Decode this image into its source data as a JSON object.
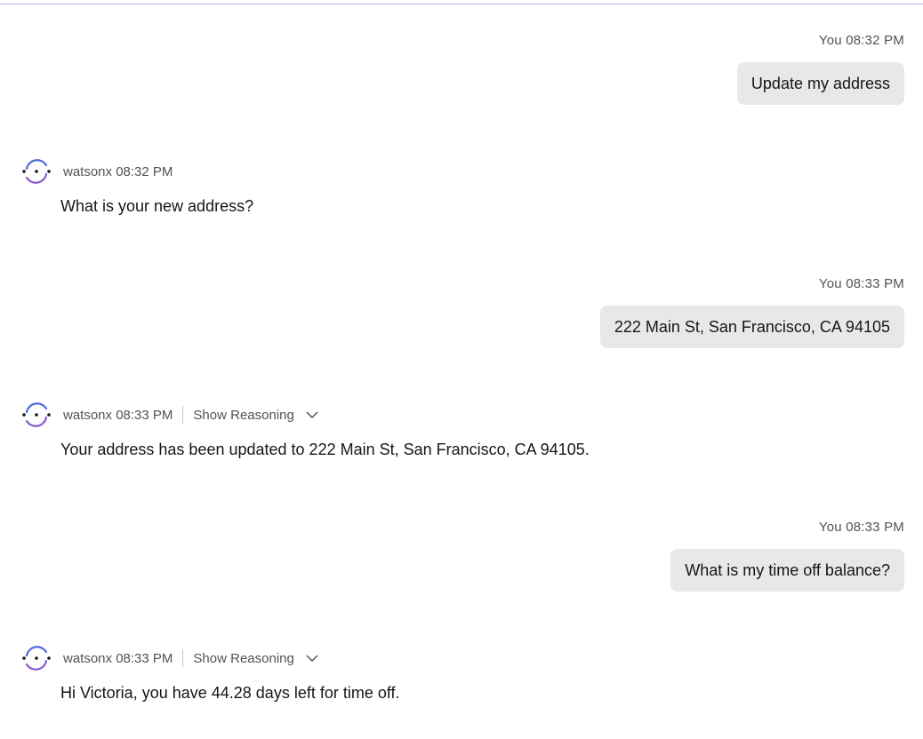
{
  "messages": [
    {
      "type": "user",
      "author": "You",
      "time": "08:32 PM",
      "text": "Update my address"
    },
    {
      "type": "bot",
      "author": "watsonx",
      "time": "08:32 PM",
      "text": "What is your new address?"
    },
    {
      "type": "user",
      "author": "You",
      "time": "08:33 PM",
      "text": "222 Main St, San Francisco, CA 94105"
    },
    {
      "type": "bot",
      "author": "watsonx",
      "time": "08:33 PM",
      "reasoning_label": "Show Reasoning",
      "text": "Your address has been updated to 222 Main St, San Francisco, CA 94105."
    },
    {
      "type": "user",
      "author": "You",
      "time": "08:33 PM",
      "text": "What is my time off balance?"
    },
    {
      "type": "bot",
      "author": "watsonx",
      "time": "08:33 PM",
      "reasoning_label": "Show Reasoning",
      "text": "Hi Victoria, you have 44.28 days left for time off."
    }
  ],
  "icons": {
    "avatar": "watsonx-avatar-icon",
    "chevron": "chevron-down-icon"
  },
  "colors": {
    "bubble_bg": "#e8e8e8",
    "meta_text": "#525252",
    "avatar_blue": "#4f6ad8",
    "avatar_purple": "#8a5cd0"
  }
}
